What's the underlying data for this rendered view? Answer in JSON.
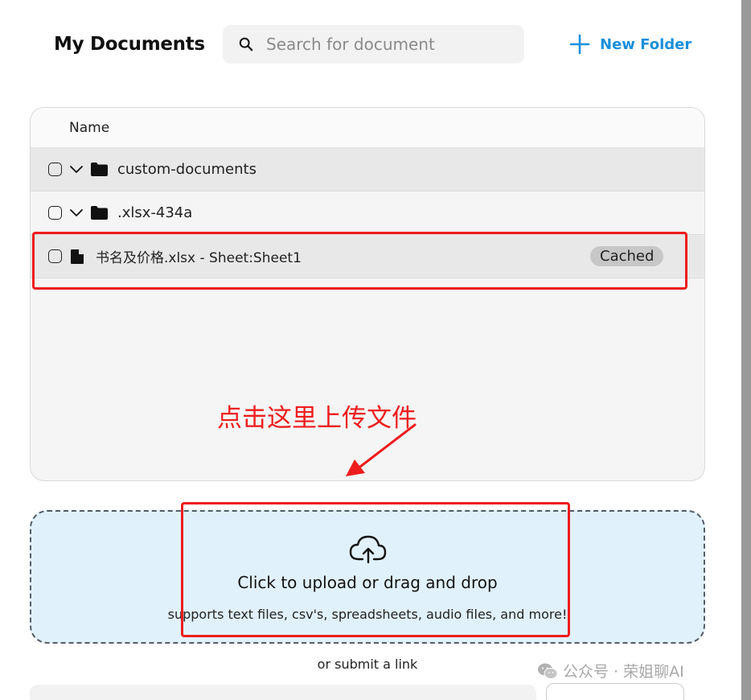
{
  "header": {
    "title": "My Documents",
    "search_placeholder": "Search for document",
    "new_folder_label": "New Folder"
  },
  "table": {
    "column_name": "Name",
    "rows": [
      {
        "type": "folder",
        "label": "custom-documents"
      },
      {
        "type": "folder",
        "label": ".xlsx-434a"
      },
      {
        "type": "file",
        "label": "书名及价格.xlsx - Sheet:Sheet1",
        "badge": "Cached"
      }
    ]
  },
  "annotation": {
    "text": "点击这里上传文件",
    "color": "#ee1c1c"
  },
  "upload": {
    "title": "Click to upload or drag and drop",
    "subtitle": "supports text files, csv's, spreadsheets, audio files, and more!",
    "submit_link_text": "or submit a link"
  },
  "watermark": {
    "text": "公众号 · 荣姐聊AI"
  },
  "colors": {
    "accent": "#1a8fdc",
    "dropzone_bg": "#e1f1fc",
    "highlight": "#ee1c1c",
    "badge_bg": "#c7c7c7"
  }
}
